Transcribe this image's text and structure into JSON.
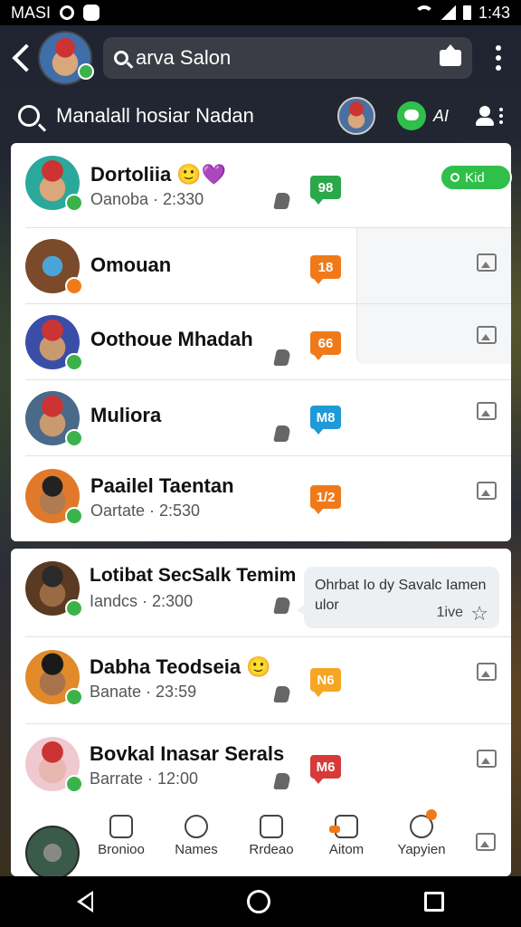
{
  "status_bar": {
    "carrier": "MASI",
    "time": "1:43"
  },
  "top_bar": {
    "search_text": "arva Salon"
  },
  "second_bar": {
    "title": "Manalall hosiar Nadan",
    "ai_label": "AI"
  },
  "online_pill": {
    "label": "Kid"
  },
  "card1": {
    "rows": [
      {
        "name": "Dortoliia",
        "emoji": "🙂💜",
        "sub": "Oanoba · 2:330",
        "tag": "98"
      },
      {
        "name": "Omouan",
        "sub": "",
        "tag": "18"
      },
      {
        "name": "Oothoue Mhadah",
        "sub": "",
        "tag": "66"
      },
      {
        "name": "Muliora",
        "sub": "",
        "tag": "M8"
      },
      {
        "name": "Paailel Taentan",
        "sub": "Oartate · 2:530",
        "tag": "1/2"
      }
    ]
  },
  "card2": {
    "rows": [
      {
        "name": "Lotibat SecSalk Temim",
        "sub": "Iandcs · 2:300",
        "preview_text": "Ohrbat Io dy Savalc Iamen ulor",
        "preview_meta": "1ive"
      },
      {
        "name": "Dabha Teodseia",
        "emoji": "🙂",
        "sub": "Banate · 23:59",
        "tag": "N6"
      },
      {
        "name": "Bovkal Inasar Serals",
        "sub": "Barrate · 12:00",
        "tag": "M6"
      }
    ]
  },
  "bottom_nav": {
    "items": [
      {
        "label": "Bronioo"
      },
      {
        "label": "Names"
      },
      {
        "label": "Rrdeao"
      },
      {
        "label": "Aitom"
      },
      {
        "label": "Yapyien"
      }
    ]
  },
  "colors": {
    "green": "#2ba84a",
    "orange": "#f07a1a",
    "blue": "#1e9ad6",
    "red": "#d83a3a",
    "yellow": "#f5a623"
  }
}
